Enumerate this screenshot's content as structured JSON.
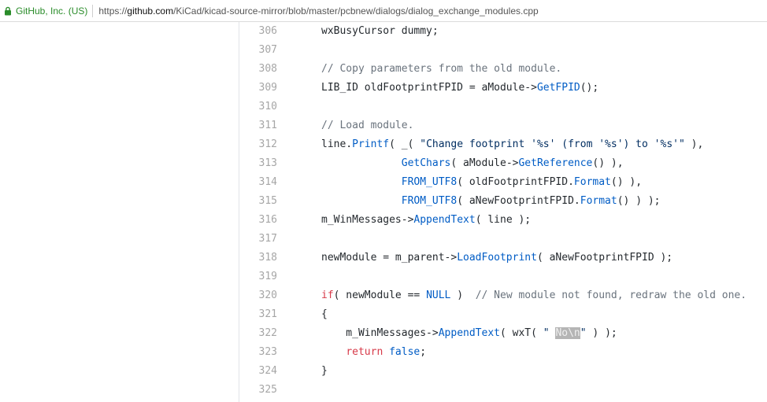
{
  "browser": {
    "site_identity": "GitHub, Inc. (US)",
    "url_prefix": "https://",
    "url_host": "github.com",
    "url_path": "/KiCad/kicad-source-mirror/blob/master/pcbnew/dialogs/dialog_exchange_modules.cpp"
  },
  "code": {
    "lines": [
      {
        "n": "306",
        "t": "    wxBusyCursor dummy;"
      },
      {
        "n": "307",
        "t": ""
      },
      {
        "n": "308",
        "t": "    // Copy parameters from the old module."
      },
      {
        "n": "309",
        "t": "    LIB_ID oldFootprintFPID = aModule->GetFPID();"
      },
      {
        "n": "310",
        "t": ""
      },
      {
        "n": "311",
        "t": "    // Load module."
      },
      {
        "n": "312",
        "t": "    line.Printf( _( \"Change footprint '%s' (from '%s') to '%s'\" ),"
      },
      {
        "n": "313",
        "t": "                 GetChars( aModule->GetReference() ),"
      },
      {
        "n": "314",
        "t": "                 FROM_UTF8( oldFootprintFPID.Format() ),"
      },
      {
        "n": "315",
        "t": "                 FROM_UTF8( aNewFootprintFPID.Format() ) );"
      },
      {
        "n": "316",
        "t": "    m_WinMessages->AppendText( line );"
      },
      {
        "n": "317",
        "t": ""
      },
      {
        "n": "318",
        "t": "    newModule = m_parent->LoadFootprint( aNewFootprintFPID );"
      },
      {
        "n": "319",
        "t": ""
      },
      {
        "n": "320",
        "t": "    if( newModule == NULL )  // New module not found, redraw the old one."
      },
      {
        "n": "321",
        "t": "    {"
      },
      {
        "n": "322",
        "t": "        m_WinMessages->AppendText( wxT( \" No\\n\" ) );"
      },
      {
        "n": "323",
        "t": "        return false;"
      },
      {
        "n": "324",
        "t": "    }"
      },
      {
        "n": "325",
        "t": ""
      }
    ]
  },
  "highlight": {
    "selected_text": "No\\n"
  },
  "colors": {
    "comment": "#6a737d",
    "function": "#005cc5",
    "string": "#032f62",
    "keyword": "#d73a49",
    "line_number": "#a6a6a6",
    "site_identity": "#2a8c2a"
  },
  "icons": {
    "address_bar": "lock-icon"
  }
}
